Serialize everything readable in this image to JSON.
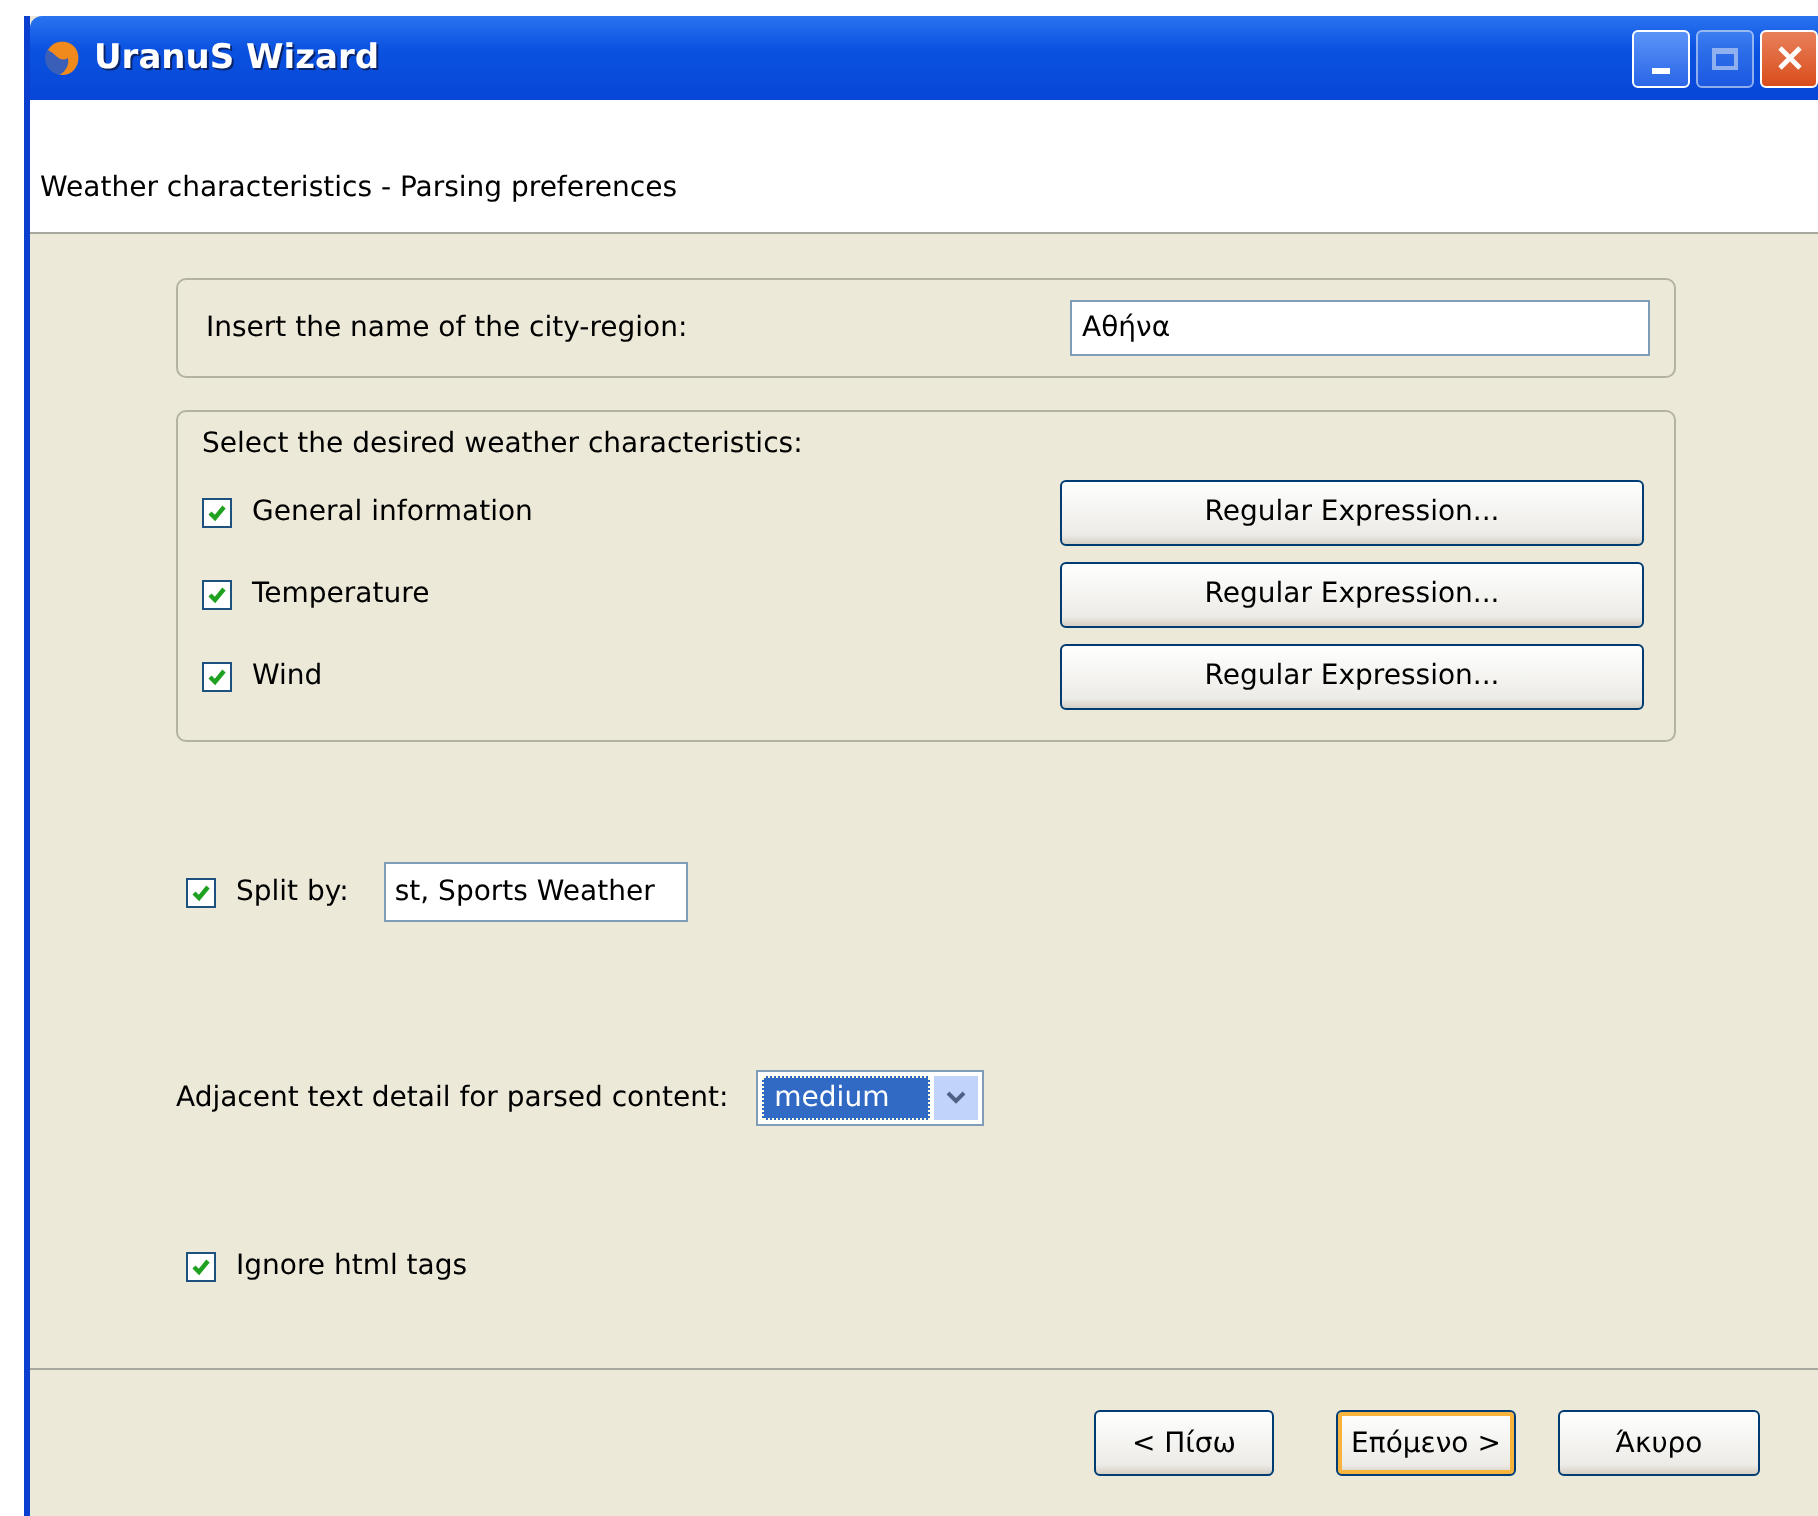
{
  "window": {
    "title": "UranuS Wizard"
  },
  "header": {
    "title": "Weather characteristics - Parsing preferences"
  },
  "city": {
    "label": "Insert the name of the city-region:",
    "value": "Αθήνα"
  },
  "characteristics": {
    "label": "Select the desired weather characteristics:",
    "items": [
      {
        "label": "General information",
        "checked": true,
        "button": "Regular Expression..."
      },
      {
        "label": "Temperature",
        "checked": true,
        "button": "Regular Expression..."
      },
      {
        "label": "Wind",
        "checked": true,
        "button": "Regular Expression..."
      }
    ]
  },
  "split": {
    "label": "Split by:",
    "checked": true,
    "value": "st, Sports Weather"
  },
  "detail": {
    "label": "Adjacent text detail for parsed content:",
    "value": "medium"
  },
  "ignore_html": {
    "label": "Ignore html tags",
    "checked": true
  },
  "buttons": [
    {
      "label": "< Πίσω",
      "default": false
    },
    {
      "label": "Επόμενο >",
      "default": true
    },
    {
      "label": "Άκυρο",
      "default": false
    }
  ]
}
